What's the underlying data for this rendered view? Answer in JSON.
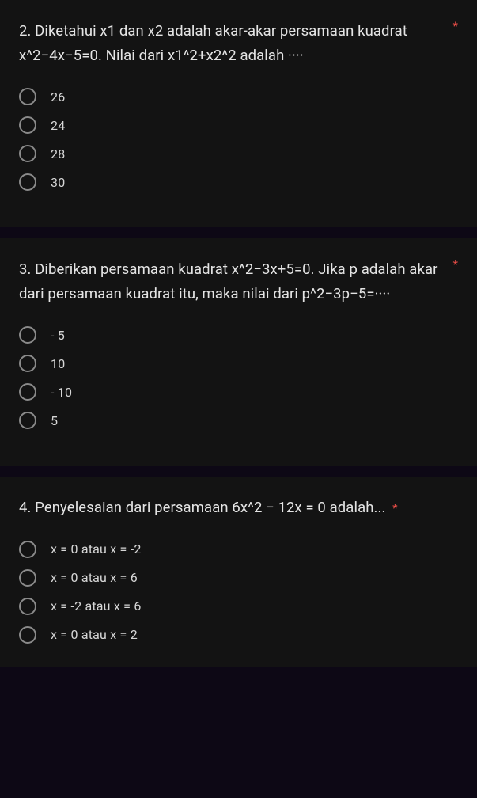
{
  "required_mark": "*",
  "questions": [
    {
      "text": "2. Diketahui x1 dan x2 adalah akar-akar persamaan kuadrat x^2−4x−5=0. Nilai dari x1^2+x2^2 adalah ····",
      "options": [
        "26",
        "24",
        "28",
        "30"
      ]
    },
    {
      "text": "3.  Diberikan persamaan kuadrat x^2−3x+5=0. Jika p adalah akar dari persamaan kuadrat itu, maka nilai dari p^2−3p−5=····",
      "options": [
        "- 5",
        "10",
        "- 10",
        "5"
      ]
    },
    {
      "text": "4. Penyelesaian dari persamaan 6x^2 − 12x = 0  adalah...",
      "options": [
        "x = 0 atau x = -2",
        "x = 0 atau x = 6",
        "x = -2 atau x = 6",
        "x = 0 atau x = 2"
      ]
    }
  ]
}
